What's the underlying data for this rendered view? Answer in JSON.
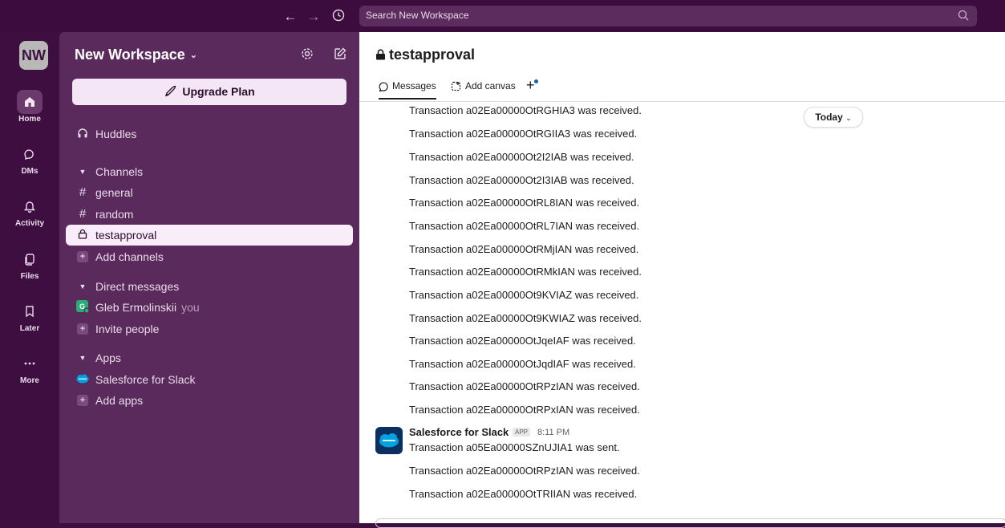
{
  "topbar": {
    "search_placeholder": "Search New Workspace"
  },
  "rail": {
    "workspace_initials": "NW",
    "items": [
      {
        "label": "Home"
      },
      {
        "label": "DMs"
      },
      {
        "label": "Activity"
      },
      {
        "label": "Files"
      },
      {
        "label": "Later"
      },
      {
        "label": "More"
      }
    ]
  },
  "sidebar": {
    "workspace_name": "New Workspace",
    "upgrade_label": "Upgrade Plan",
    "huddles_label": "Huddles",
    "channels_header": "Channels",
    "channels": [
      {
        "name": "general"
      },
      {
        "name": "random"
      },
      {
        "name": "testapproval"
      }
    ],
    "add_channels_label": "Add channels",
    "dm_header": "Direct messages",
    "dm_user": "Gleb Ermolinskii",
    "dm_you": "you",
    "invite_label": "Invite people",
    "apps_header": "Apps",
    "app_name": "Salesforce for Slack",
    "add_apps_label": "Add apps"
  },
  "main": {
    "channel_name": "testapproval",
    "tabs": [
      {
        "label": "Messages"
      },
      {
        "label": "Add canvas"
      }
    ],
    "today_label": "Today",
    "messages": [
      "Transaction a02Ea00000OtRGHIA3 was received.",
      "Transaction a02Ea00000OtRGIIA3 was received.",
      "Transaction a02Ea00000Ot2I2IAB was received.",
      "Transaction a02Ea00000Ot2I3IAB was received.",
      "Transaction a02Ea00000OtRL8IAN was received.",
      "Transaction a02Ea00000OtRL7IAN was received.",
      "Transaction a02Ea00000OtRMjIAN was received.",
      "Transaction a02Ea00000OtRMkIAN was received.",
      "Transaction a02Ea00000Ot9KVIAZ was received.",
      "Transaction a02Ea00000Ot9KWIAZ was received.",
      "Transaction a02Ea00000OtJqeIAF was received.",
      "Transaction a02Ea00000OtJqdIAF was received.",
      "Transaction a02Ea00000OtRPzIAN was received.",
      "Transaction a02Ea00000OtRPxIAN was received."
    ],
    "sender": "Salesforce for Slack",
    "app_badge": "APP",
    "time": "8:11 PM",
    "messages_after": [
      "Transaction a05Ea00000SZnUJIA1 was sent.",
      "Transaction a02Ea00000OtRPzIAN was received.",
      "Transaction a02Ea00000OtTRIIAN was received."
    ]
  },
  "colors": {
    "aubergine": "#3f0e40",
    "sidebar": "#5b2a5c",
    "salesforce_blue": "#00a1e0",
    "notification_dot": "#1264a3"
  }
}
